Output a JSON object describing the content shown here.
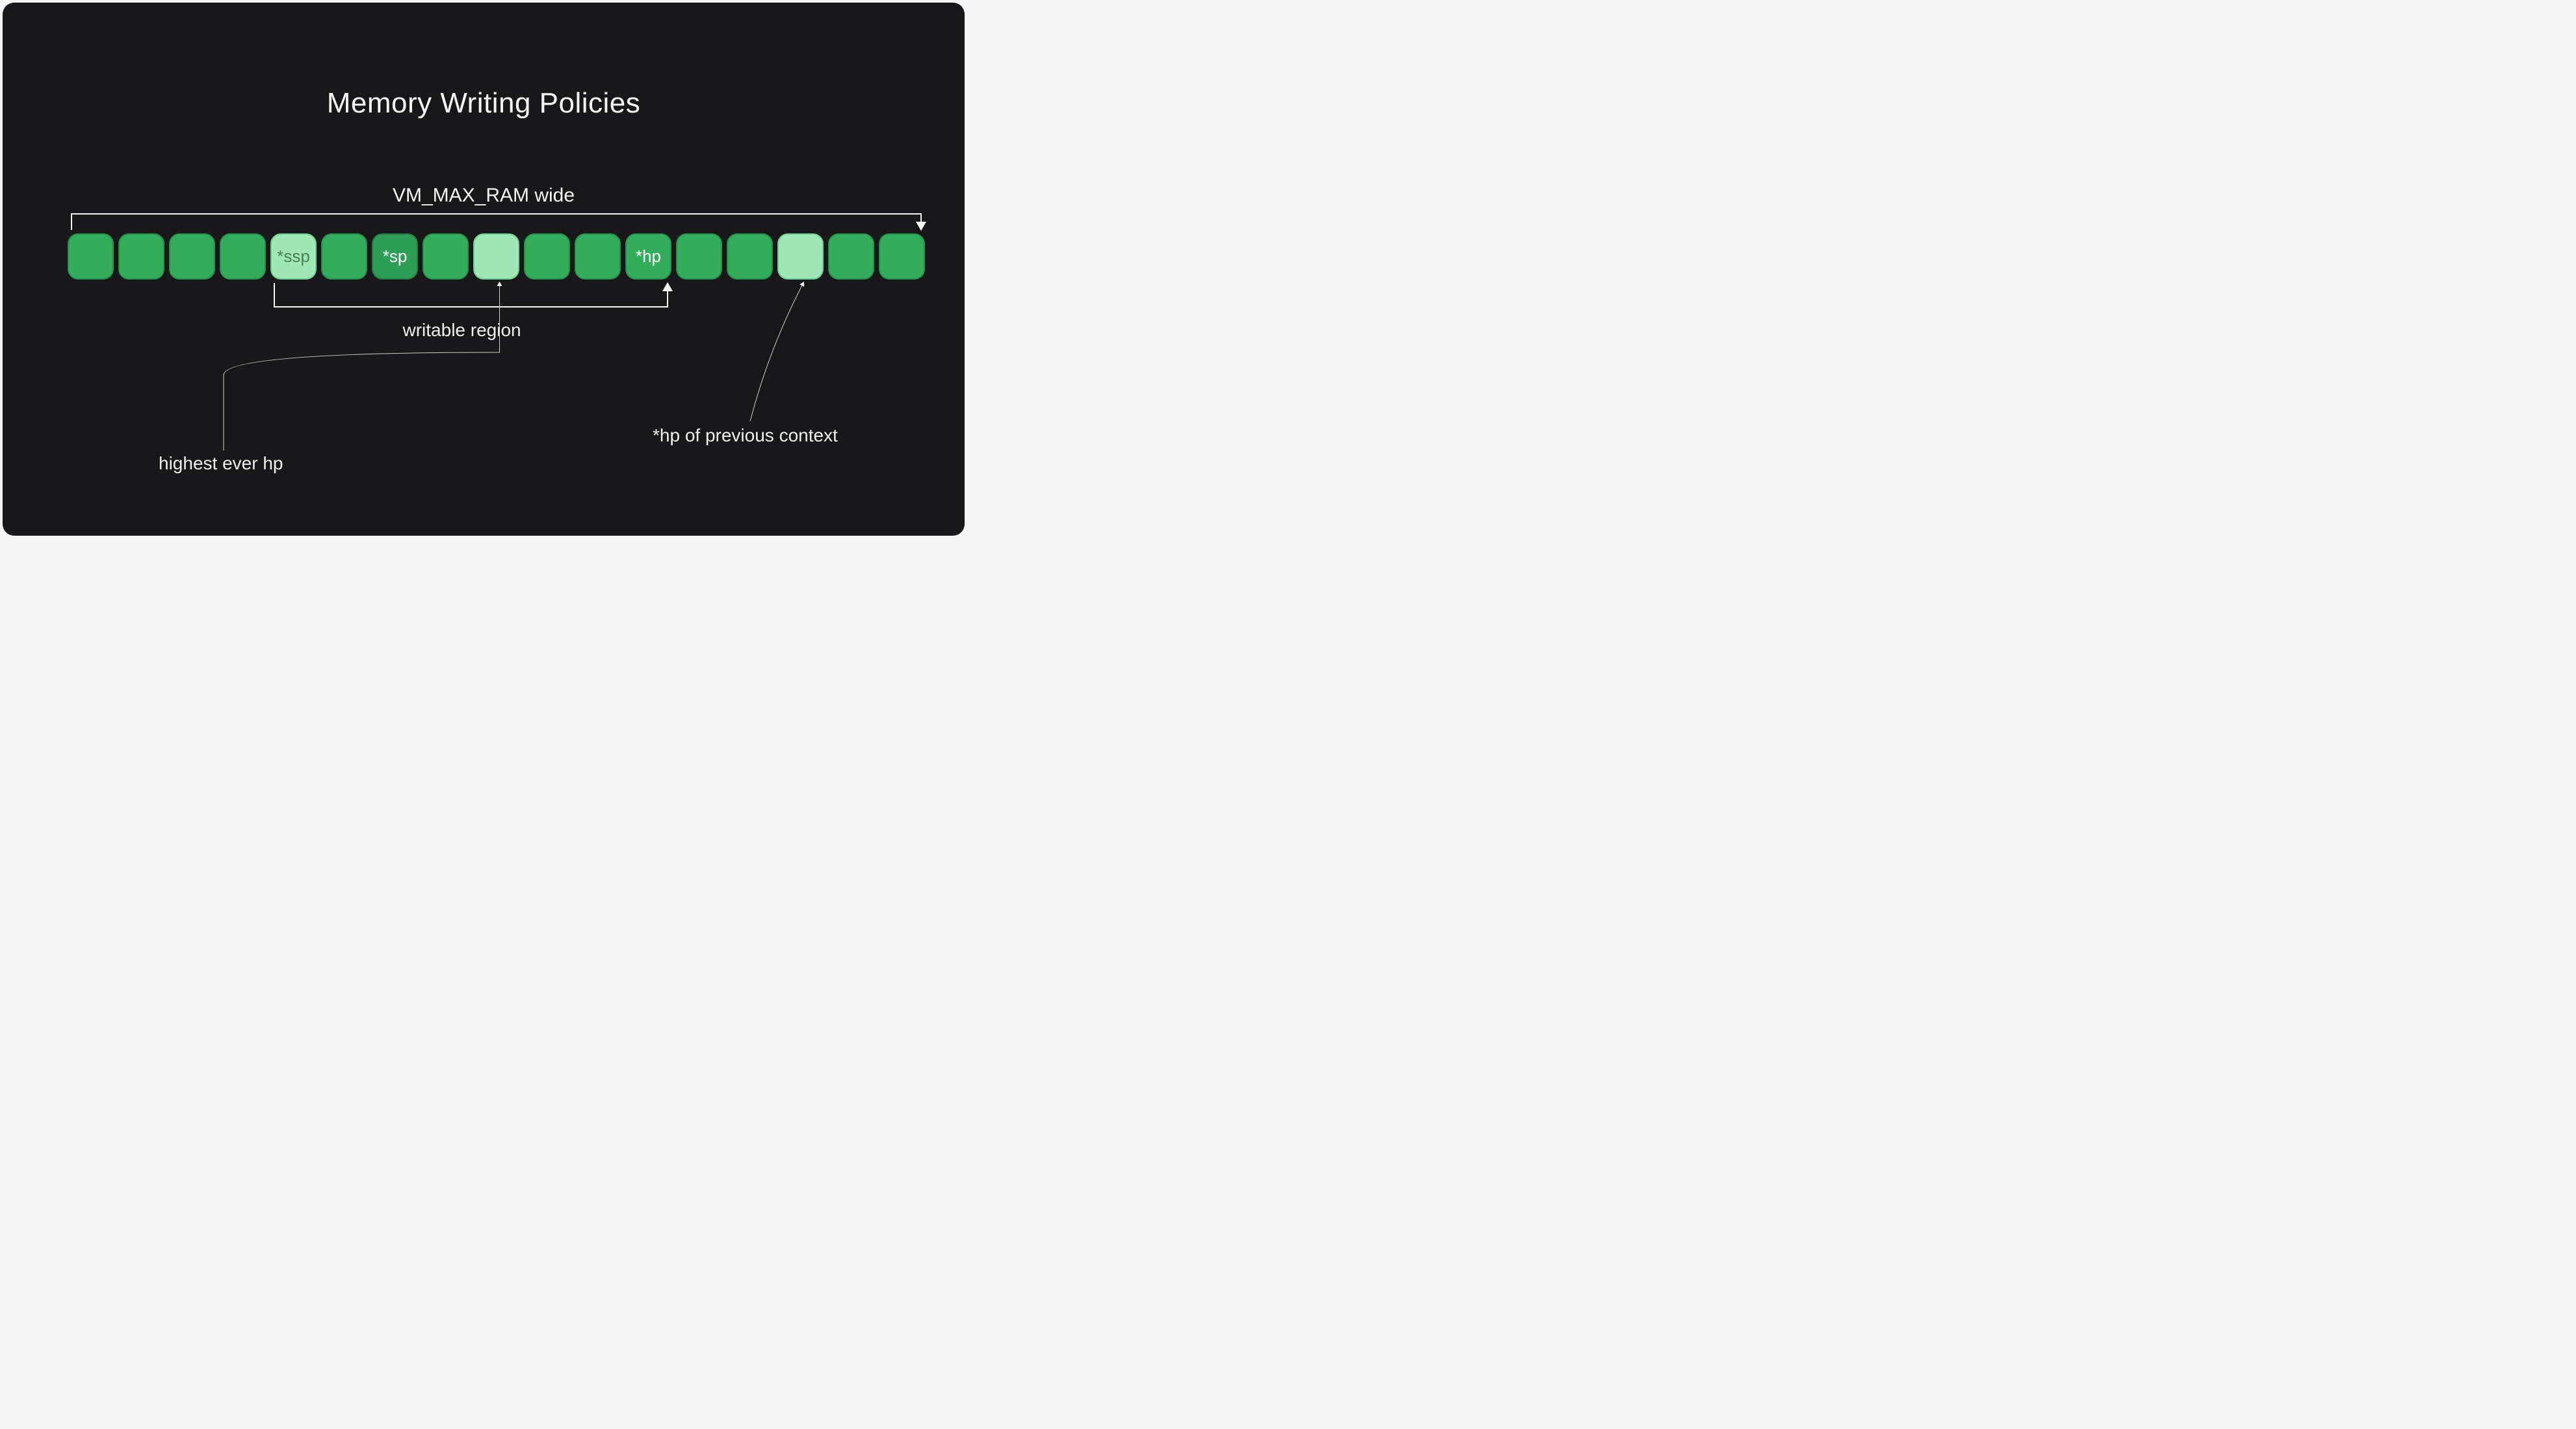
{
  "title": "Memory Writing Policies",
  "topLabel": "VM_MAX_RAM wide",
  "cells": [
    {
      "label": "",
      "kind": "mid"
    },
    {
      "label": "",
      "kind": "mid"
    },
    {
      "label": "",
      "kind": "mid"
    },
    {
      "label": "",
      "kind": "mid"
    },
    {
      "label": "*ssp",
      "kind": "light"
    },
    {
      "label": "",
      "kind": "mid"
    },
    {
      "label": "*sp",
      "kind": "dark"
    },
    {
      "label": "",
      "kind": "mid"
    },
    {
      "label": "",
      "kind": "light"
    },
    {
      "label": "",
      "kind": "mid"
    },
    {
      "label": "",
      "kind": "mid"
    },
    {
      "label": "*hp",
      "kind": "mid"
    },
    {
      "label": "",
      "kind": "mid"
    },
    {
      "label": "",
      "kind": "mid"
    },
    {
      "label": "",
      "kind": "light"
    },
    {
      "label": "",
      "kind": "mid"
    },
    {
      "label": "",
      "kind": "mid"
    }
  ],
  "annotations": {
    "writable": "writable region",
    "highestHp": "highest ever hp",
    "prevHp": "*hp of previous context"
  }
}
